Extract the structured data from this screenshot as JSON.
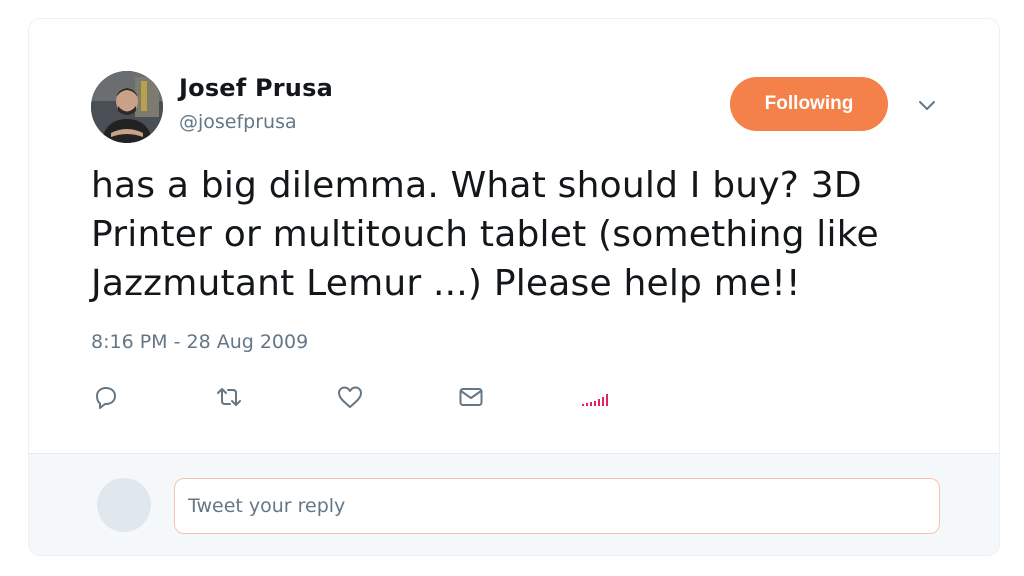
{
  "tweet": {
    "author": {
      "name": "Josef Prusa",
      "handle": "@josefprusa"
    },
    "follow_label": "Following",
    "text": "has a big dilemma. What should I buy? 3D Printer or multitouch tablet (something like Jazzmutant Lemur ...) Please help me!!",
    "timestamp": "8:16 PM - 28 Aug 2009"
  },
  "actions": {
    "icons": [
      "reply-icon",
      "retweet-icon",
      "like-icon",
      "direct-message-icon",
      "analytics-icon"
    ]
  },
  "reply": {
    "placeholder": "Tweet your reply"
  },
  "colors": {
    "accent": "#f4804a",
    "text": "#14171a",
    "secondary": "#657786",
    "analytics": "#e0245e"
  }
}
